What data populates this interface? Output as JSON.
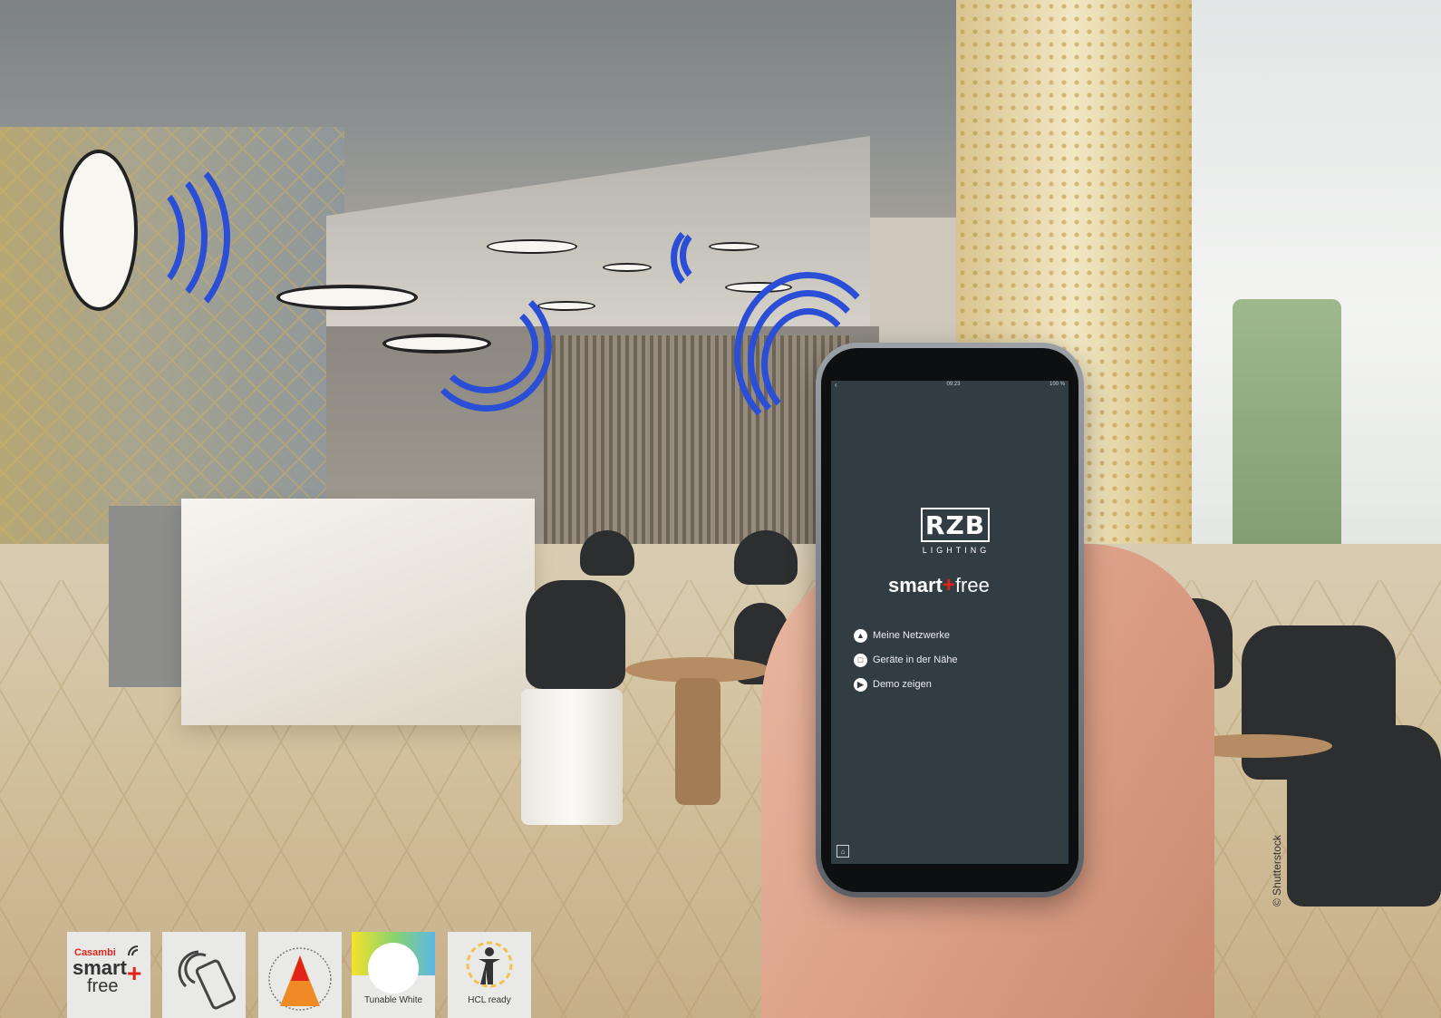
{
  "phone": {
    "status_time": "09:23",
    "status_battery": "100 %",
    "brand": "RZB",
    "brand_sub": "LIGHTING",
    "app_logo": {
      "smart": "smart",
      "plus": "+",
      "free": "free"
    },
    "menu": [
      {
        "icon": "network-icon",
        "label": "Meine Netzwerke"
      },
      {
        "icon": "device-icon",
        "label": "Geräte in der Nähe"
      },
      {
        "icon": "play-icon",
        "label": "Demo zeigen"
      }
    ]
  },
  "badges": {
    "casambi": {
      "top": "Casambi",
      "smart": "smart",
      "plus": "+",
      "free": "free"
    },
    "tunable_white": "Tunable White",
    "hcl_ready": "HCL ready"
  },
  "credit": "© Shutterstock",
  "colors": {
    "accent_red": "#e2231a",
    "wireless_blue": "#2a4fd6",
    "app_bg": "#323c43"
  }
}
